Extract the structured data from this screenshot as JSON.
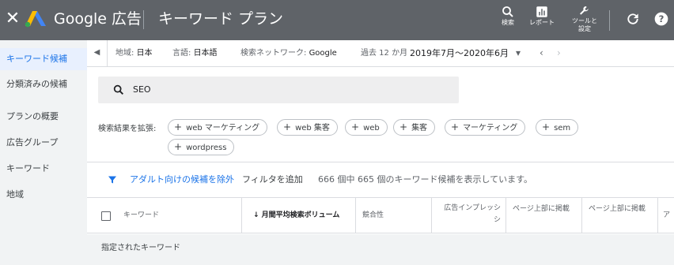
{
  "header": {
    "close_icon": "close-icon",
    "brand": "Google 広告",
    "title": "キーワード プラン",
    "tools": [
      {
        "label": "検索",
        "icon": "search-icon"
      },
      {
        "label": "レポート",
        "icon": "report-icon"
      },
      {
        "label": "ツールと\n設定",
        "icon": "wrench-icon"
      }
    ],
    "refresh_icon": "refresh-icon",
    "help_icon": "help-icon"
  },
  "sidebar": {
    "items": [
      {
        "label": "キーワード候補",
        "active": true
      },
      {
        "label": "分類済みの候補",
        "active": false
      },
      {
        "label": "プランの概要",
        "active": false
      },
      {
        "label": "広告グループ",
        "active": false
      },
      {
        "label": "キーワード",
        "active": false
      },
      {
        "label": "地域",
        "active": false
      }
    ]
  },
  "filters": {
    "location_label": "地域:",
    "location_value": "日本",
    "language_label": "言語:",
    "language_value": "日本語",
    "network_label": "検索ネットワーク:",
    "network_value": "Google",
    "period_label": "過去 12 か月",
    "date_range": "2019年7月〜2020年6月"
  },
  "search": {
    "value": "SEO"
  },
  "suggestions": {
    "label": "検索結果を拡張:",
    "chips": [
      "web マーケティング",
      "web 集客",
      "web",
      "集客",
      "マーケティング",
      "sem",
      "wordpress"
    ]
  },
  "filter_row": {
    "adult_filter": "アダルト向けの候補を除外",
    "add_filter": "フィルタを追加",
    "count_text": "666 個中 665 個のキーワード候補を表示しています。"
  },
  "table": {
    "columns": [
      "キーワード",
      "↓ 月間平均検索ボリューム",
      "競合性",
      "広告インプレッシ\nシ",
      "ページ上部に掲載",
      "ページ上部に掲載",
      "ア"
    ],
    "group_label": "指定されたキーワード"
  },
  "colors": {
    "topbar": "#5f6368",
    "accent": "#1a73e8",
    "sidebar_bg": "#f1f3f4"
  }
}
